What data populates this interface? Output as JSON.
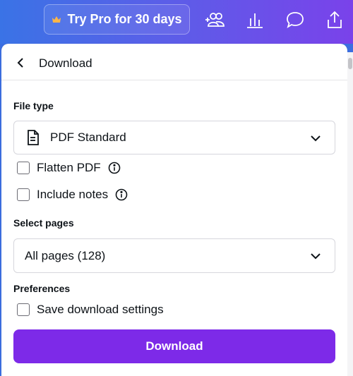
{
  "topbar": {
    "pro_button_label": "Try Pro for 30 days",
    "icons": [
      "crown-icon",
      "share-people-icon",
      "insights-chart-icon",
      "comment-icon",
      "upload-share-icon"
    ]
  },
  "panel": {
    "title": "Download",
    "file_type": {
      "label": "File type",
      "selected": "PDF Standard",
      "icon": "document-icon"
    },
    "options": {
      "flatten_pdf": "Flatten PDF",
      "include_notes": "Include notes"
    },
    "select_pages": {
      "label": "Select pages",
      "selected": "All pages (128)"
    },
    "preferences": {
      "label": "Preferences",
      "save_settings": "Save download settings"
    },
    "download_button": "Download"
  },
  "colors": {
    "gradient_start": "#3a73e6",
    "gradient_end": "#7a42ea",
    "primary_button": "#7d2ae8"
  }
}
